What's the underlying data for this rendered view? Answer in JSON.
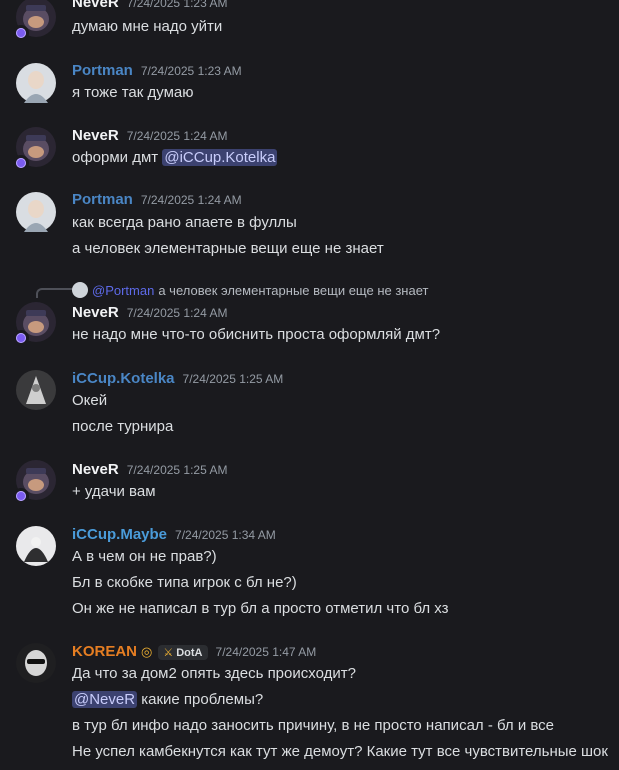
{
  "users": {
    "never": {
      "name": "NeveR",
      "color": "#f2f3f5"
    },
    "portman": {
      "name": "Portman",
      "color": "#4a86c5"
    },
    "kotelka": {
      "name": "iCCup.Kotelka",
      "color": "#4a86c5"
    },
    "maybe": {
      "name": "iCCup.Maybe",
      "color": "#4a9bd9"
    },
    "korean": {
      "name": "KOREAN",
      "color": "#e67e22"
    }
  },
  "messages": [
    {
      "author": "NeveR",
      "time": "7/24/2025 1:23 AM",
      "lines": [
        "думаю мне надо уйти"
      ]
    },
    {
      "author": "Portman",
      "time": "7/24/2025 1:23 AM",
      "lines": [
        "я тоже так думаю"
      ]
    },
    {
      "author": "NeveR",
      "time": "7/24/2025 1:24 AM",
      "line_text": "оформи дмт",
      "mention": "@iCCup.Kotelka"
    },
    {
      "author": "Portman",
      "time": "7/24/2025 1:24 AM",
      "lines": [
        "как всегда рано апаете в фуллы",
        "а человек элементарные вещи еще не знает"
      ]
    },
    {
      "author": "NeveR",
      "time": "7/24/2025 1:24 AM",
      "reply": {
        "mention": "@Portman",
        "text": "а человек элементарные вещи еще не знает"
      },
      "lines": [
        "не надо мне что-то обиснить проста оформляй дмт?"
      ]
    },
    {
      "author": "iCCup.Kotelka",
      "time": "7/24/2025 1:25 AM",
      "lines": [
        "Окей",
        "после турнира"
      ]
    },
    {
      "author": "NeveR",
      "time": "7/24/2025 1:25 AM",
      "lines": [
        "+ удачи вам"
      ]
    },
    {
      "author": "iCCup.Maybe",
      "time": "7/24/2025 1:34 AM",
      "lines": [
        "А в чем он не прав?)",
        "Бл в скобке типа игрок с бл не?)",
        "Он же не написал в тур бл а просто отметил что бл хз"
      ]
    },
    {
      "author": "KOREAN",
      "time": "7/24/2025 1:47 AM",
      "badge": "DotA",
      "lines": [
        "Да что за дом2 опять здесь происходит?",
        "в тур бл инфо надо заносить причину, в не просто написал - бл и все",
        "Не успел камбекнутся как тут же демоут? Какие тут все чувствительные шок"
      ],
      "mention_line": {
        "mention": "@NeveR",
        "text": " какие проблемы?"
      }
    }
  ],
  "icons": {
    "status": "nitro-status-icon",
    "badge": "sword-icon",
    "ring": "ring-icon"
  }
}
